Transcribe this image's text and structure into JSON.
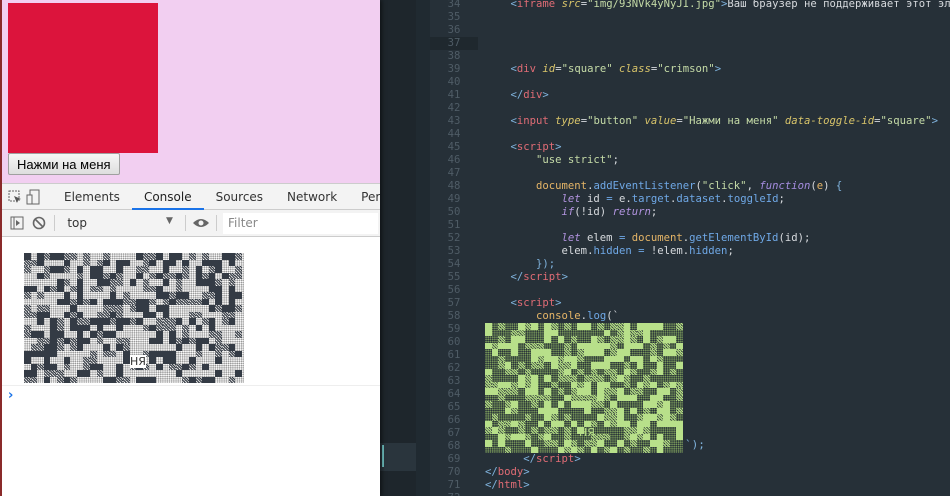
{
  "browser": {
    "button_label": "Нажми на меня",
    "square_color": "#dc143c"
  },
  "devtools": {
    "tabs": [
      "Elements",
      "Console",
      "Sources",
      "Network",
      "Perf"
    ],
    "active_tab": "Console",
    "context": "top",
    "filter_placeholder": "Filter",
    "prompt": "›",
    "art_label": "НЯ"
  },
  "editor": {
    "art_label": "НЯ",
    "art_closing": "`);",
    "lines": [
      {
        "n": "34",
        "tokens": [
          {
            "c": "br",
            "t": "    <"
          },
          {
            "c": "tag",
            "t": "iframe"
          },
          {
            "c": "t",
            "t": " "
          },
          {
            "c": "at",
            "t": "src"
          },
          {
            "c": "pu",
            "t": "="
          },
          {
            "c": "st",
            "t": "\"img/93NVk4yNyJI.jpg\""
          },
          {
            "c": "br",
            "t": ">"
          },
          {
            "c": "t",
            "t": "Ваш браузер не поддерживает этот элемент"
          }
        ]
      },
      {
        "n": "35",
        "tokens": []
      },
      {
        "n": "36",
        "tokens": []
      },
      {
        "n": "37",
        "hl": true,
        "mark": true,
        "tokens": []
      },
      {
        "n": "38",
        "mark": true,
        "tokens": []
      },
      {
        "n": "39",
        "mark": true,
        "tokens": [
          {
            "c": "br",
            "t": "    <"
          },
          {
            "c": "tag",
            "t": "div"
          },
          {
            "c": "t",
            "t": " "
          },
          {
            "c": "at",
            "t": "id"
          },
          {
            "c": "pu",
            "t": "="
          },
          {
            "c": "st",
            "t": "\"square\""
          },
          {
            "c": "t",
            "t": " "
          },
          {
            "c": "at",
            "t": "class"
          },
          {
            "c": "pu",
            "t": "="
          },
          {
            "c": "st",
            "t": "\"crimson\""
          },
          {
            "c": "br",
            "t": ">"
          }
        ]
      },
      {
        "n": "40",
        "mark": true,
        "tokens": []
      },
      {
        "n": "41",
        "mark": true,
        "tokens": [
          {
            "c": "br",
            "t": "    </"
          },
          {
            "c": "tag",
            "t": "div"
          },
          {
            "c": "br",
            "t": ">"
          }
        ]
      },
      {
        "n": "42",
        "tokens": []
      },
      {
        "n": "43",
        "mark": true,
        "tokens": [
          {
            "c": "br",
            "t": "    <"
          },
          {
            "c": "tag",
            "t": "input"
          },
          {
            "c": "t",
            "t": " "
          },
          {
            "c": "at",
            "t": "type"
          },
          {
            "c": "pu",
            "t": "="
          },
          {
            "c": "st",
            "t": "\"button\""
          },
          {
            "c": "t",
            "t": " "
          },
          {
            "c": "at",
            "t": "value"
          },
          {
            "c": "pu",
            "t": "="
          },
          {
            "c": "st",
            "t": "\"Нажми на меня\""
          },
          {
            "c": "t",
            "t": " "
          },
          {
            "c": "at",
            "t": "data-toggle-id"
          },
          {
            "c": "pu",
            "t": "="
          },
          {
            "c": "st",
            "t": "\"square\""
          },
          {
            "c": "br",
            "t": ">"
          }
        ]
      },
      {
        "n": "44",
        "tokens": []
      },
      {
        "n": "45",
        "tokens": [
          {
            "c": "br",
            "t": "    <"
          },
          {
            "c": "tag",
            "t": "script"
          },
          {
            "c": "br",
            "t": ">"
          }
        ]
      },
      {
        "n": "46",
        "tokens": [
          {
            "c": "st",
            "t": "        \"use strict\""
          },
          {
            "c": "pu",
            "t": ";"
          }
        ]
      },
      {
        "n": "47",
        "tokens": []
      },
      {
        "n": "48",
        "mark": true,
        "tokens": [
          {
            "c": "ob",
            "t": "        document"
          },
          {
            "c": "pu",
            "t": "."
          },
          {
            "c": "fn",
            "t": "addEventListener"
          },
          {
            "c": "pu",
            "t": "("
          },
          {
            "c": "st",
            "t": "\"click\""
          },
          {
            "c": "pu",
            "t": ", "
          },
          {
            "c": "fk",
            "t": "function"
          },
          {
            "c": "pu",
            "t": "("
          },
          {
            "c": "ob",
            "t": "e"
          },
          {
            "c": "pu",
            "t": ") "
          },
          {
            "c": "br",
            "t": "{"
          }
        ]
      },
      {
        "n": "49",
        "mark": true,
        "tokens": [
          {
            "c": "kw",
            "t": "            let"
          },
          {
            "c": "t",
            "t": " id "
          },
          {
            "c": "fn",
            "t": "="
          },
          {
            "c": "t",
            "t": " e"
          },
          {
            "c": "pu",
            "t": "."
          },
          {
            "c": "fn",
            "t": "target"
          },
          {
            "c": "pu",
            "t": "."
          },
          {
            "c": "fn",
            "t": "dataset"
          },
          {
            "c": "pu",
            "t": "."
          },
          {
            "c": "fn",
            "t": "toggleId"
          },
          {
            "c": "pu",
            "t": ";"
          }
        ]
      },
      {
        "n": "50",
        "mark": true,
        "tokens": [
          {
            "c": "kw",
            "t": "            if"
          },
          {
            "c": "pu",
            "t": "(!id) "
          },
          {
            "c": "kw",
            "t": "return"
          },
          {
            "c": "pu",
            "t": ";"
          }
        ]
      },
      {
        "n": "51",
        "mark": true,
        "tokens": []
      },
      {
        "n": "52",
        "mark": true,
        "tokens": [
          {
            "c": "kw",
            "t": "            let"
          },
          {
            "c": "t",
            "t": " elem "
          },
          {
            "c": "fn",
            "t": "="
          },
          {
            "c": "ob",
            "t": " document"
          },
          {
            "c": "pu",
            "t": "."
          },
          {
            "c": "fn",
            "t": "getElementById"
          },
          {
            "c": "pu",
            "t": "(id);"
          }
        ]
      },
      {
        "n": "53",
        "mark": true,
        "tokens": [
          {
            "c": "t",
            "t": "            elem"
          },
          {
            "c": "pu",
            "t": "."
          },
          {
            "c": "fn",
            "t": "hidden"
          },
          {
            "c": "fn",
            "t": " = "
          },
          {
            "c": "t",
            "t": "!elem"
          },
          {
            "c": "pu",
            "t": "."
          },
          {
            "c": "fn",
            "t": "hidden"
          },
          {
            "c": "pu",
            "t": ";"
          }
        ]
      },
      {
        "n": "54",
        "mark": true,
        "tokens": [
          {
            "c": "br",
            "t": "        });"
          }
        ]
      },
      {
        "n": "55",
        "tokens": [
          {
            "c": "br",
            "t": "    </"
          },
          {
            "c": "tag",
            "t": "script"
          },
          {
            "c": "br",
            "t": ">"
          }
        ]
      },
      {
        "n": "56",
        "tokens": []
      },
      {
        "n": "57",
        "tokens": [
          {
            "c": "br",
            "t": "    <"
          },
          {
            "c": "tag",
            "t": "script"
          },
          {
            "c": "br",
            "t": ">"
          }
        ]
      },
      {
        "n": "58",
        "tokens": [
          {
            "c": "ob",
            "t": "        console"
          },
          {
            "c": "pu",
            "t": "."
          },
          {
            "c": "fn",
            "t": "log"
          },
          {
            "c": "pu",
            "t": "(`"
          }
        ]
      },
      {
        "n": "59",
        "tokens": []
      },
      {
        "n": "60",
        "tokens": []
      },
      {
        "n": "61",
        "tokens": []
      },
      {
        "n": "62",
        "tokens": []
      },
      {
        "n": "63",
        "tokens": []
      },
      {
        "n": "64",
        "tokens": []
      },
      {
        "n": "65",
        "tokens": []
      },
      {
        "n": "66",
        "tokens": []
      },
      {
        "n": "67",
        "tokens": []
      },
      {
        "n": "68",
        "tokens": []
      },
      {
        "n": "69",
        "tokens": [
          {
            "c": "br",
            "t": "      </"
          },
          {
            "c": "tag",
            "t": "script"
          },
          {
            "c": "br",
            "t": ">"
          }
        ]
      },
      {
        "n": "70",
        "tokens": [
          {
            "c": "br",
            "t": "</"
          },
          {
            "c": "tag",
            "t": "body"
          },
          {
            "c": "br",
            "t": ">"
          }
        ]
      },
      {
        "n": "71",
        "tokens": [
          {
            "c": "br",
            "t": "</"
          },
          {
            "c": "tag",
            "t": "html"
          },
          {
            "c": "br",
            "t": ">"
          }
        ]
      },
      {
        "n": "72",
        "tokens": []
      }
    ]
  }
}
